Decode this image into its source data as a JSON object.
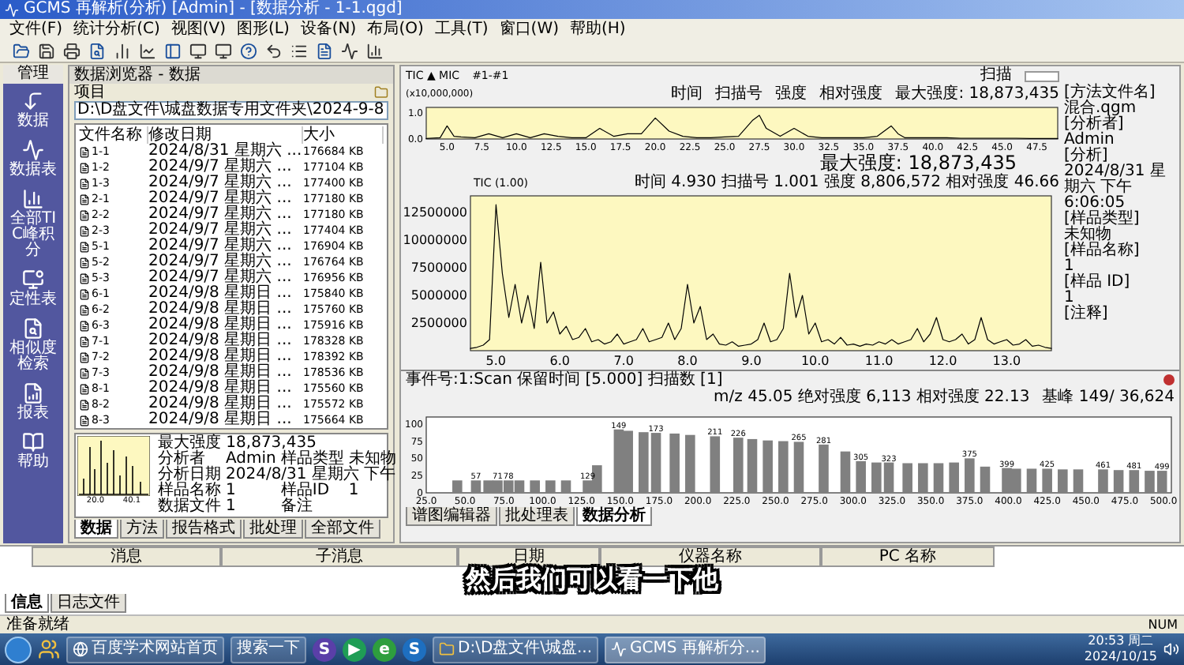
{
  "window": {
    "title": "GCMS 再解析(分析) [Admin] - [数据分析 - 1-1.qgd]"
  },
  "menu": [
    "文件(F)",
    "统计分析(C)",
    "视图(V)",
    "图形(L)",
    "设备(N)",
    "布局(O)",
    "工具(T)",
    "窗口(W)",
    "帮助(H)"
  ],
  "nav": {
    "title": "管理",
    "items": [
      "数据",
      "数据表",
      "全部TIC峰积分",
      "定性表",
      "相似度检索",
      "报表",
      "帮助"
    ]
  },
  "browser": {
    "title": "数据浏览器 - 数据",
    "project_label": "项目",
    "path": "D:\\D盘文件\\城盘数据专用文件夹\\2024-9-8",
    "columns": [
      "文件名称",
      "修改日期",
      "大小"
    ],
    "files": [
      {
        "name": "1-1",
        "date": "2024/8/31 星期六 ...",
        "size": "176684 KB"
      },
      {
        "name": "1-2",
        "date": "2024/9/7 星期六 ...",
        "size": "177104 KB"
      },
      {
        "name": "1-3",
        "date": "2024/9/7 星期六 ...",
        "size": "177400 KB"
      },
      {
        "name": "2-1",
        "date": "2024/9/7 星期六 ...",
        "size": "177180 KB"
      },
      {
        "name": "2-2",
        "date": "2024/9/7 星期六 ...",
        "size": "177180 KB"
      },
      {
        "name": "2-3",
        "date": "2024/9/7 星期六 ...",
        "size": "177404 KB"
      },
      {
        "name": "5-1",
        "date": "2024/9/7 星期六 ...",
        "size": "176904 KB"
      },
      {
        "name": "5-2",
        "date": "2024/9/7 星期六 ...",
        "size": "176764 KB"
      },
      {
        "name": "5-3",
        "date": "2024/9/7 星期六 ...",
        "size": "176956 KB"
      },
      {
        "name": "6-1",
        "date": "2024/9/8 星期日 ...",
        "size": "175840 KB"
      },
      {
        "name": "6-2",
        "date": "2024/9/8 星期日 ...",
        "size": "175760 KB"
      },
      {
        "name": "6-3",
        "date": "2024/9/8 星期日 ...",
        "size": "175916 KB"
      },
      {
        "name": "7-1",
        "date": "2024/9/8 星期日 ...",
        "size": "178328 KB"
      },
      {
        "name": "7-2",
        "date": "2024/9/8 星期日 ...",
        "size": "178392 KB"
      },
      {
        "name": "7-3",
        "date": "2024/9/8 星期日 ...",
        "size": "178536 KB"
      },
      {
        "name": "8-1",
        "date": "2024/9/8 星期日 ...",
        "size": "175560 KB"
      },
      {
        "name": "8-2",
        "date": "2024/9/8 星期日 ...",
        "size": "175572 KB"
      },
      {
        "name": "8-3",
        "date": "2024/9/8 星期日 ...",
        "size": "175664 KB"
      }
    ],
    "preview": {
      "title": "最大强度 18,873,435",
      "axis_labels": [
        "20.0",
        "40.1"
      ],
      "info": [
        {
          "label": "分析者",
          "value": "Admin"
        },
        {
          "label": "样品类型",
          "value": "未知物"
        },
        {
          "label": "分析日期",
          "value": "2024/8/31 星期六 下午"
        },
        {
          "label": "样品名称",
          "value": "1"
        },
        {
          "label": "样品ID",
          "value": "1"
        },
        {
          "label": "数据文件",
          "value": "1"
        },
        {
          "label": "备注"
        }
      ]
    },
    "tabs": [
      {
        "label": "数据",
        "selected": true
      },
      {
        "label": "方法",
        "selected": false
      },
      {
        "label": "报告格式",
        "selected": false
      },
      {
        "label": "批处理",
        "selected": false
      },
      {
        "label": "全部文件",
        "selected": false
      }
    ]
  },
  "analysis": {
    "trace": "TIC ▲ MIC",
    "channel": "#1-#1",
    "scan_label": "扫描",
    "overview": {
      "scale": "(x10,000,000)",
      "readout": [
        "时间",
        "扫描号",
        "强度",
        "相对强度"
      ],
      "max_intensity": "最大强度: 18,873,435",
      "chart_data": {
        "type": "line",
        "x": [
          3.5,
          4.5,
          5,
          5.5,
          6,
          7,
          8,
          9,
          10,
          11,
          12,
          13,
          14,
          15,
          16,
          17,
          18,
          19,
          20,
          21,
          22,
          23,
          24,
          25,
          26,
          27,
          27.5,
          28,
          29,
          30,
          31,
          32,
          33,
          34,
          35,
          36,
          37,
          37.5,
          38,
          39,
          40,
          41,
          42,
          43,
          44,
          45,
          46,
          47,
          48,
          49
        ],
        "series": [
          {
            "color": "#000000",
            "values": [
              0.02,
              0.05,
              0.5,
              0.1,
              0.08,
              0.05,
              0.2,
              0.05,
              0.2,
              0.05,
              0.2,
              0.1,
              0.05,
              0.05,
              0.4,
              0.1,
              0.2,
              0.2,
              0.8,
              0.3,
              0.1,
              0.05,
              0.05,
              0.08,
              0.1,
              0.7,
              0.9,
              0.4,
              0.1,
              0.4,
              0.1,
              0.05,
              0.05,
              0.05,
              0.05,
              0.1,
              0.5,
              0.2,
              0.05,
              0.05,
              0.05,
              0.05,
              0.03,
              0.03,
              0.03,
              0.03,
              0.03,
              0.02,
              0.02,
              0.02
            ]
          }
        ],
        "xlim": [
          3.5,
          49
        ],
        "ylim": [
          0,
          1.2
        ],
        "yticks": [
          {
            "value": 0,
            "label": "0.0"
          },
          {
            "value": 1,
            "label": "1.0"
          }
        ],
        "xticks": [
          {
            "value": 5,
            "label": "5.0"
          },
          {
            "value": 7.5,
            "label": "7.5"
          },
          {
            "value": 10,
            "label": "10.0"
          },
          {
            "value": 12.5,
            "label": "12.5"
          },
          {
            "value": 15,
            "label": "15.0"
          },
          {
            "value": 17.5,
            "label": "17.5"
          },
          {
            "value": 20,
            "label": "20.0"
          },
          {
            "value": 22.5,
            "label": "22.5"
          },
          {
            "value": 25,
            "label": "25.0"
          },
          {
            "value": 27.5,
            "label": "27.5"
          },
          {
            "value": 30,
            "label": "30.0"
          },
          {
            "value": 32.5,
            "label": "32.5"
          },
          {
            "value": 35,
            "label": "35.0"
          },
          {
            "value": 37.5,
            "label": "37.5"
          },
          {
            "value": 40,
            "label": "40.0"
          },
          {
            "value": 42.5,
            "label": "42.5"
          },
          {
            "value": 45,
            "label": "45.0"
          },
          {
            "value": 47.5,
            "label": "47.5"
          }
        ]
      }
    },
    "chromatogram": {
      "max_intensity": "最大强度: 18,873,435",
      "trace_label": "TIC (1.00)",
      "readout": "时间 4.930 扫描号 1.001 强度 8,806,572 相对强度 46.66",
      "chart_data": {
        "type": "line",
        "x": [
          4.6,
          4.7,
          4.8,
          4.9,
          5.0,
          5.1,
          5.2,
          5.3,
          5.4,
          5.5,
          5.6,
          5.7,
          5.8,
          5.9,
          6.0,
          6.1,
          6.2,
          6.3,
          6.4,
          6.5,
          6.6,
          6.7,
          6.8,
          6.9,
          7.0,
          7.1,
          7.2,
          7.3,
          7.4,
          7.5,
          7.6,
          7.7,
          7.8,
          7.9,
          8.0,
          8.1,
          8.2,
          8.3,
          8.4,
          8.5,
          8.6,
          8.7,
          8.8,
          8.9,
          9.0,
          9.1,
          9.2,
          9.3,
          9.4,
          9.5,
          9.6,
          9.7,
          9.8,
          9.9,
          10.0,
          10.1,
          10.2,
          10.3,
          10.4,
          10.5,
          10.6,
          10.7,
          10.8,
          10.9,
          11.0,
          11.1,
          11.2,
          11.3,
          11.4,
          11.5,
          11.6,
          11.7,
          11.8,
          11.9,
          12.0,
          12.1,
          12.2,
          12.3,
          12.4,
          12.5,
          12.6,
          12.7,
          12.8,
          12.9,
          13.0,
          13.1,
          13.2,
          13.3,
          13.4,
          13.5,
          13.6,
          13.7
        ],
        "series": [
          {
            "color": "#000000",
            "values": [
              200000,
              300000,
              500000,
              1000000,
              13200000,
              7000000,
              3000000,
              6000000,
              2500000,
              5000000,
              2000000,
              8000000,
              2500000,
              3500000,
              1500000,
              2200000,
              1000000,
              1200000,
              2000000,
              800000,
              1000000,
              600000,
              800000,
              1500000,
              600000,
              800000,
              1000000,
              2000000,
              800000,
              1000000,
              1200000,
              2500000,
              1000000,
              2000000,
              6000000,
              2500000,
              4000000,
              1000000,
              1500000,
              600000,
              500000,
              800000,
              400000,
              500000,
              600000,
              1000000,
              2500000,
              800000,
              1000000,
              2000000,
              7000000,
              3000000,
              5000000,
              1500000,
              2500000,
              800000,
              1000000,
              600000,
              1200000,
              500000,
              600000,
              400000,
              600000,
              500000,
              800000,
              600000,
              1000000,
              600000,
              800000,
              1000000,
              2000000,
              800000,
              1500000,
              3000000,
              1000000,
              800000,
              1000000,
              1500000,
              600000,
              1000000,
              3000000,
              1000000,
              600000,
              800000,
              1000000,
              500000,
              600000,
              1000000,
              400000,
              500000,
              300000,
              200000
            ]
          }
        ],
        "xlim": [
          4.6,
          13.7
        ],
        "ylim": [
          0,
          14000000
        ],
        "yticks": [
          2500000,
          5000000,
          7500000,
          10000000,
          12500000
        ],
        "xticks": [
          {
            "value": 5,
            "label": "5.0"
          },
          {
            "value": 6,
            "label": "6.0"
          },
          {
            "value": 7,
            "label": "7.0"
          },
          {
            "value": 8,
            "label": "8.0"
          },
          {
            "value": 9,
            "label": "9.0"
          },
          {
            "value": 10,
            "label": "10.0"
          },
          {
            "value": 11,
            "label": "11.0"
          },
          {
            "value": 12,
            "label": "12.0"
          },
          {
            "value": 13,
            "label": "13.0"
          }
        ]
      }
    },
    "sample_info": [
      {
        "label": "[方法文件名]",
        "value": "混合.qgm"
      },
      {
        "label": "[分析者]",
        "value": "Admin"
      },
      {
        "label": "[分析]",
        "value": "2024/8/31 星期六 下午 6:06:05"
      },
      {
        "label": "[样品类型]",
        "value": "未知物"
      },
      {
        "label": "[样品名称]",
        "value": "1"
      },
      {
        "label": "[样品 ID]",
        "value": "1"
      },
      {
        "label": "[注释]"
      }
    ],
    "spectrum": {
      "header": "事件号:1:Scan 保留时间 [5.000] 扫描数 [1]",
      "base_peak": "基峰 149/ 36,624",
      "readout": "m/z 45.05 绝对强度 6,113 相对强度 22.13",
      "chart_data": {
        "type": "bar",
        "x": [
          45,
          57,
          65,
          71,
          78,
          85,
          95,
          105,
          115,
          129,
          135,
          149,
          155,
          165,
          173,
          185,
          195,
          211,
          226,
          235,
          245,
          255,
          265,
          281,
          295,
          305,
          315,
          323,
          335,
          345,
          355,
          365,
          375,
          385,
          399,
          405,
          415,
          425,
          435,
          445,
          461,
          471,
          481,
          491,
          499
        ],
        "series": [
          {
            "color": "#808080",
            "values": [
              18,
              18,
              18,
              18,
              18,
              18,
              18,
              18,
              18,
              18,
              40,
              92,
              90,
              88,
              87,
              86,
              84,
              82,
              80,
              78,
              76,
              75,
              74,
              70,
              60,
              46,
              44,
              44,
              43,
              43,
              43,
              44,
              50,
              38,
              36,
              35,
              35,
              35,
              34,
              34,
              34,
              33,
              33,
              32,
              32
            ]
          }
        ],
        "value_labels": [
          null,
          "57",
          null,
          "71",
          "78",
          null,
          null,
          null,
          null,
          "129",
          null,
          "149",
          null,
          null,
          "173",
          null,
          null,
          "211",
          "226",
          null,
          null,
          null,
          "265",
          "281",
          null,
          "305",
          null,
          "323",
          null,
          null,
          null,
          null,
          "375",
          null,
          "399",
          null,
          null,
          "425",
          null,
          null,
          "461",
          null,
          "481",
          null,
          "499"
        ],
        "xlim": [
          25,
          505
        ],
        "ylim": [
          0,
          110
        ],
        "yticks": [
          0,
          25,
          50,
          75,
          100
        ],
        "xticks": [
          {
            "value": 25,
            "label": "25.0"
          },
          {
            "value": 50,
            "label": "50.0"
          },
          {
            "value": 75,
            "label": "75.0"
          },
          {
            "value": 100,
            "label": "100.0"
          },
          {
            "value": 125,
            "label": "125.0"
          },
          {
            "value": 150,
            "label": "150.0"
          },
          {
            "value": 175,
            "label": "175.0"
          },
          {
            "value": 200,
            "label": "200.0"
          },
          {
            "value": 225,
            "label": "225.0"
          },
          {
            "value": 250,
            "label": "250.0"
          },
          {
            "value": 275,
            "label": "275.0"
          },
          {
            "value": 300,
            "label": "300.0"
          },
          {
            "value": 325,
            "label": "325.0"
          },
          {
            "value": 350,
            "label": "350.0"
          },
          {
            "value": 375,
            "label": "375.0"
          },
          {
            "value": 400,
            "label": "400.0"
          },
          {
            "value": 425,
            "label": "425.0"
          },
          {
            "value": 450,
            "label": "450.0"
          },
          {
            "value": 475,
            "label": "475.0"
          },
          {
            "value": 500,
            "label": "500.0"
          }
        ]
      }
    },
    "view_tabs": [
      {
        "label": "谱图编辑器",
        "selected": false
      },
      {
        "label": "批处理表",
        "selected": false
      },
      {
        "label": "数据分析",
        "selected": true
      }
    ]
  },
  "output": {
    "columns": [
      "消息",
      "子消息",
      "日期",
      "仪器名称",
      "PC 名称"
    ],
    "tabs": [
      {
        "label": "信息",
        "selected": true
      },
      {
        "label": "日志文件",
        "selected": false
      }
    ]
  },
  "status": {
    "text": "准备就绪",
    "num": "NUM"
  },
  "taskbar": {
    "pinned": [
      {
        "label": "百度学术网站首页"
      },
      {
        "label": "搜索一下"
      }
    ],
    "apps": [
      {
        "glyph": "S",
        "color": "#5a3fa8"
      },
      {
        "glyph": "▶",
        "color": "#1f9d55"
      },
      {
        "glyph": "e",
        "color": "#2e9e3e"
      },
      {
        "glyph": "S",
        "color": "#1e6fc0"
      }
    ],
    "windows": [
      {
        "label": "D:\\D盘文件\\城盘...",
        "selected": false
      },
      {
        "label": "GCMS 再解析分...",
        "selected": true
      }
    ],
    "time": "20:53 周二",
    "date": "2024/10/15"
  },
  "subtitle": "然后我们可以看一下他"
}
